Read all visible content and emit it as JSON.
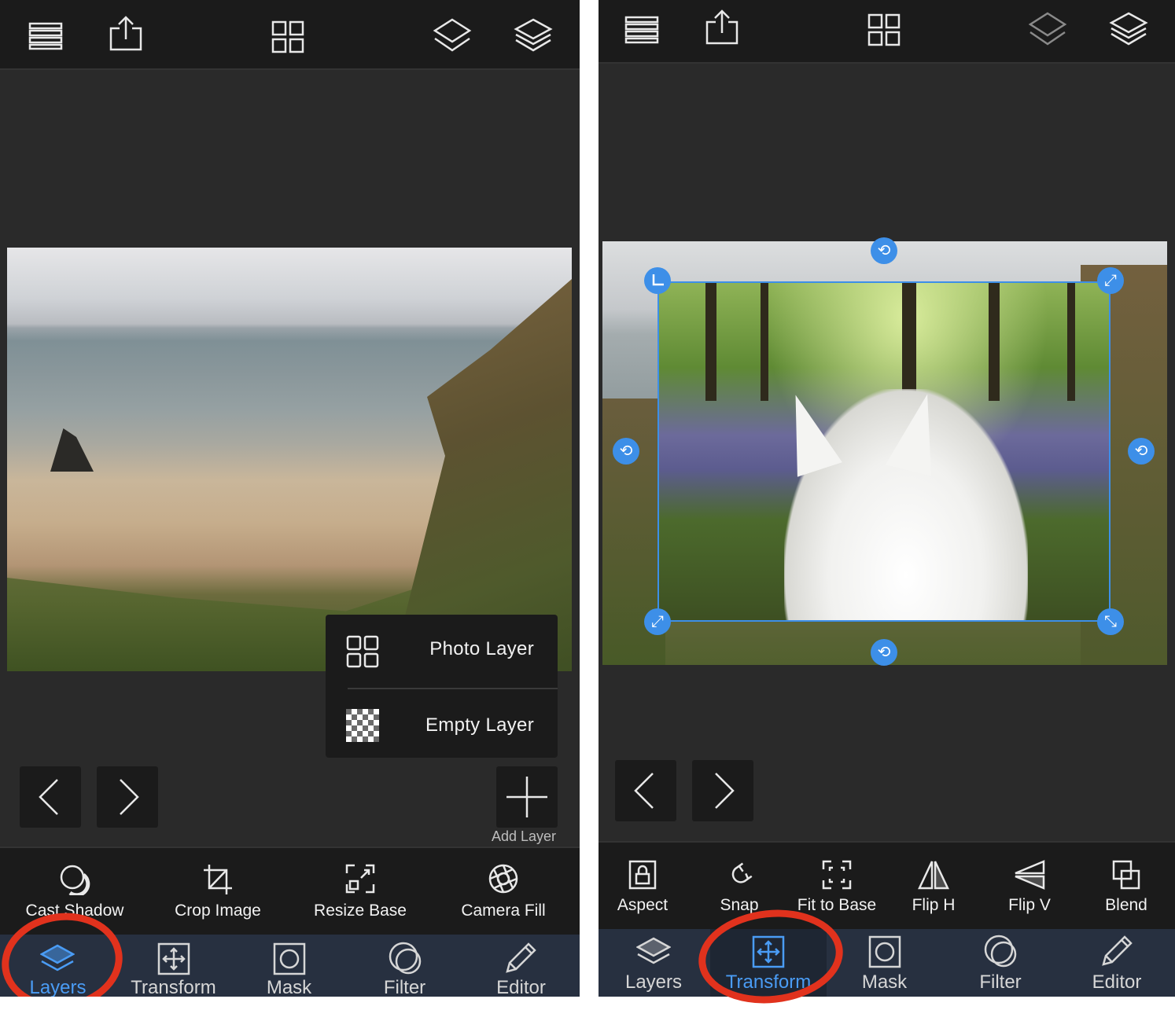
{
  "colors": {
    "accent": "#3d8fe8",
    "annotation": "#e1321d",
    "toolbar_bg": "#1b1b1b",
    "tabbar_bg": "#273040"
  },
  "left_screen": {
    "topbar_icons": [
      "list-icon",
      "share-icon",
      "grid-icon",
      "layer-single-icon",
      "layers-stack-icon"
    ],
    "add_menu": {
      "items": [
        {
          "icon": "grid-icon",
          "label": "Photo Layer"
        },
        {
          "icon": "checkerboard-icon",
          "label": "Empty Layer"
        }
      ]
    },
    "add_layer_label": "Add Layer",
    "tools": [
      {
        "icon": "cast-shadow-icon",
        "label": "Cast Shadow"
      },
      {
        "icon": "crop-icon",
        "label": "Crop Image"
      },
      {
        "icon": "resize-base-icon",
        "label": "Resize Base"
      },
      {
        "icon": "aperture-icon",
        "label": "Camera Fill"
      }
    ],
    "tabs": [
      {
        "icon": "layers-icon",
        "label": "Layers",
        "active": true
      },
      {
        "icon": "transform-icon",
        "label": "Transform",
        "active": false
      },
      {
        "icon": "mask-icon",
        "label": "Mask",
        "active": false
      },
      {
        "icon": "filter-icon",
        "label": "Filter",
        "active": false
      },
      {
        "icon": "pencil-icon",
        "label": "Editor",
        "active": false
      }
    ]
  },
  "right_screen": {
    "topbar_icons": [
      "list-icon",
      "share-icon",
      "grid-icon",
      "layer-single-icon",
      "layers-stack-icon"
    ],
    "tools": [
      {
        "icon": "lock-icon",
        "label": "Aspect"
      },
      {
        "icon": "magnet-icon",
        "label": "Snap"
      },
      {
        "icon": "fit-icon",
        "label": "Fit to Base"
      },
      {
        "icon": "flip-h-icon",
        "label": "Flip H"
      },
      {
        "icon": "flip-v-icon",
        "label": "Flip V"
      },
      {
        "icon": "blend-icon",
        "label": "Blend"
      }
    ],
    "tabs": [
      {
        "icon": "layers-icon",
        "label": "Layers",
        "active": false
      },
      {
        "icon": "transform-icon",
        "label": "Transform",
        "active": true
      },
      {
        "icon": "mask-icon",
        "label": "Mask",
        "active": false
      },
      {
        "icon": "filter-icon",
        "label": "Filter",
        "active": false
      },
      {
        "icon": "pencil-icon",
        "label": "Editor",
        "active": false
      }
    ]
  }
}
